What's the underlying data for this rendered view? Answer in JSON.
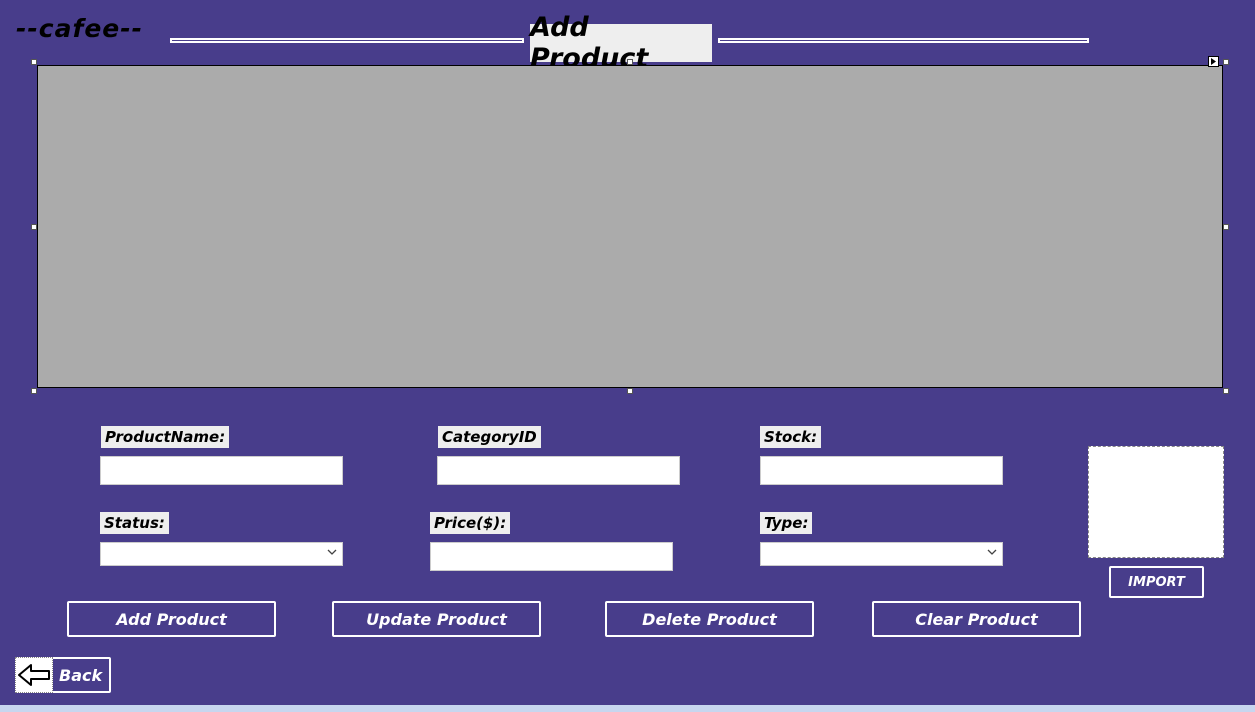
{
  "brand": {
    "text": "--cafee--"
  },
  "header": {
    "title": "Add Product"
  },
  "form": {
    "product_name": {
      "label": "ProductName:",
      "value": ""
    },
    "category_id": {
      "label": "CategoryID",
      "value": ""
    },
    "stock": {
      "label": "Stock:",
      "value": ""
    },
    "status": {
      "label": "Status:",
      "selected": ""
    },
    "price": {
      "label": "Price($):",
      "value": ""
    },
    "type": {
      "label": "Type:",
      "selected": ""
    }
  },
  "buttons": {
    "add": "Add Product",
    "update": "Update Product",
    "delete": "Delete Product",
    "clear": "Clear Product",
    "import": "IMPORT",
    "back": "Back"
  },
  "icons": {
    "back": "back-arrow-icon",
    "dropdown": "chevron-down-icon",
    "smart_tag": "smart-tag-arrow-icon"
  },
  "colors": {
    "background": "#483D8B",
    "grid": "#ABABAB",
    "label_bg": "#EEEEEE",
    "button_border": "#FFFFFF",
    "bottom_strip": "#C7D6EF"
  }
}
